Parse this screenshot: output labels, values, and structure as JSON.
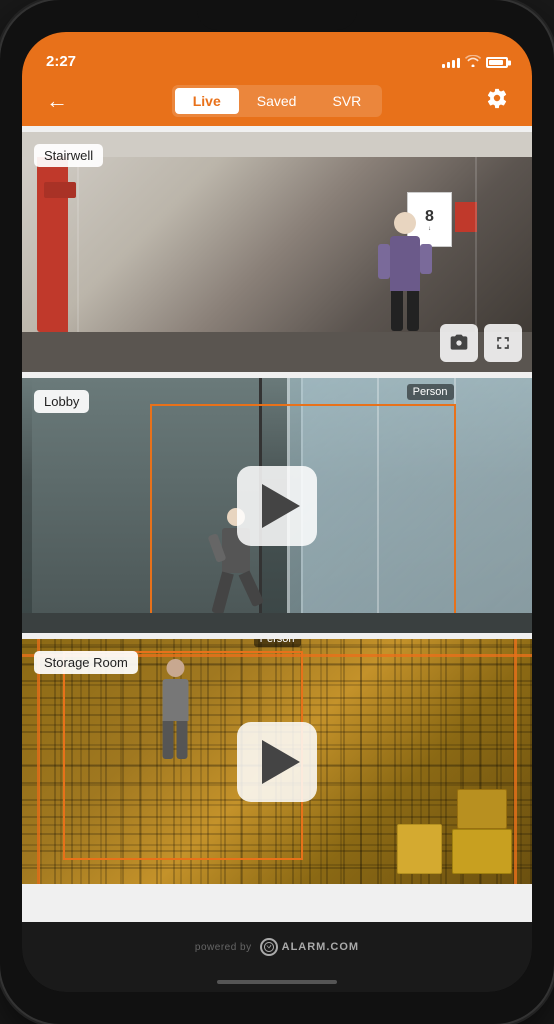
{
  "status_bar": {
    "time": "2:27",
    "signal_bars": [
      3,
      5,
      8,
      10,
      12
    ],
    "battery_level": "85%"
  },
  "nav": {
    "back_label": "←",
    "tabs": [
      {
        "id": "live",
        "label": "Live",
        "active": true
      },
      {
        "id": "saved",
        "label": "Saved",
        "active": false
      },
      {
        "id": "svr",
        "label": "SVR",
        "active": false
      }
    ],
    "settings_label": "⚙"
  },
  "cameras": [
    {
      "id": "stairwell",
      "name": "Stairwell",
      "type": "live",
      "has_detection": false,
      "has_controls": true,
      "snapshot_icon": "📷",
      "fullscreen_icon": "⛶"
    },
    {
      "id": "lobby",
      "name": "Lobby",
      "type": "paused",
      "has_detection": true,
      "detection_label": "Person",
      "has_controls": false
    },
    {
      "id": "storage",
      "name": "Storage Room",
      "type": "paused",
      "has_detection": true,
      "detection_label": "Person",
      "has_controls": false
    }
  ],
  "footer": {
    "powered_by": "powered by",
    "brand": "ALARM.COM"
  },
  "colors": {
    "accent": "#E8711A",
    "nav_bg": "#E8711A",
    "active_tab_bg": "#FFFFFF",
    "active_tab_text": "#E8711A"
  }
}
